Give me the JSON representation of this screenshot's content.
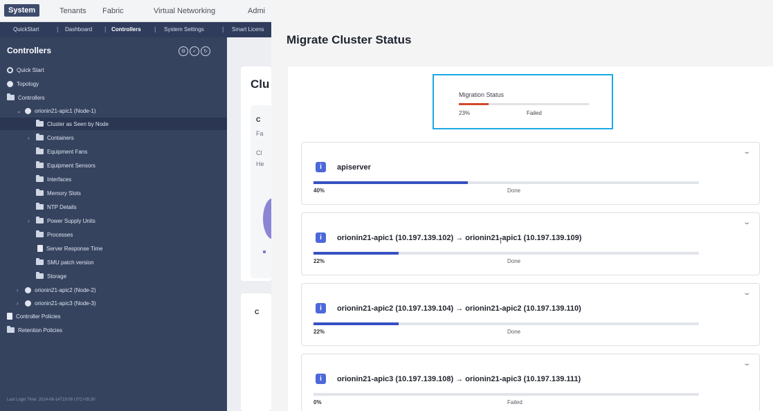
{
  "topnav": {
    "tabs": [
      "System",
      "Tenants",
      "Fabric",
      "Virtual Networking",
      "Admi"
    ],
    "active_tab": 0
  },
  "subnav": {
    "items": [
      "QuickStart",
      "Dashboard",
      "Controllers",
      "System Settings",
      "Smart Licens"
    ],
    "active_item": 2
  },
  "sidebar": {
    "title": "Controllers",
    "tree": [
      {
        "label": "Quick Start",
        "icon": "play-icon"
      },
      {
        "label": "Topology",
        "icon": "globe-icon"
      },
      {
        "label": "Controllers",
        "icon": "folder-icon"
      },
      {
        "label": "orionin21-apic1 (Node-1)",
        "icon": "node-icon"
      },
      {
        "label": "Cluster as Seen by Node",
        "icon": "folder-icon"
      },
      {
        "label": "Containers",
        "icon": "folder-icon"
      },
      {
        "label": "Equipment Fans",
        "icon": "folder-icon"
      },
      {
        "label": "Equipment Sensors",
        "icon": "folder-icon"
      },
      {
        "label": "Interfaces",
        "icon": "folder-icon"
      },
      {
        "label": "Memory Slots",
        "icon": "folder-icon"
      },
      {
        "label": "NTP Details",
        "icon": "folder-icon"
      },
      {
        "label": "Power Supply Units",
        "icon": "folder-icon"
      },
      {
        "label": "Processes",
        "icon": "folder-icon"
      },
      {
        "label": "Server Response Time",
        "icon": "document-icon"
      },
      {
        "label": "SMU patch version",
        "icon": "folder-icon"
      },
      {
        "label": "Storage",
        "icon": "folder-icon"
      },
      {
        "label": "orionin21-apic2 (Node-2)",
        "icon": "node-icon"
      },
      {
        "label": "orionin21-apic3 (Node-3)",
        "icon": "node-icon"
      },
      {
        "label": "Controller Policies",
        "icon": "document-icon"
      },
      {
        "label": "Retention Policies",
        "icon": "folder-icon"
      }
    ],
    "footer": "Last Login Time: 2024-06-14T19:08 UTC+05:30"
  },
  "background_page": {
    "title": "Clu",
    "letters": [
      "C",
      "Fa",
      "Cl",
      "He",
      "C"
    ]
  },
  "modal": {
    "title": "Migrate Cluster Status",
    "migration": {
      "label": "Migration Status",
      "percent": "23%",
      "progress": 0.23,
      "status": "Failed",
      "bar_color": "#d4462b"
    },
    "tasks": [
      {
        "title": "apiserver",
        "percent": "40%",
        "progress": 0.4,
        "status": "Done"
      },
      {
        "title": "orionin21-apic1 (10.197.139.102) → orionin21-apic1 (10.197.139.109)",
        "percent": "22%",
        "progress": 0.22,
        "status": "Done"
      },
      {
        "title": "orionin21-apic2 (10.197.139.104) → orionin21-apic2 (10.197.139.110)",
        "percent": "22%",
        "progress": 0.22,
        "status": "Done"
      },
      {
        "title": "orionin21-apic3 (10.197.139.108) → orionin21-apic3 (10.197.139.111)",
        "percent": "0%",
        "progress": 0.0,
        "status": "Failed"
      }
    ]
  },
  "colors": {
    "highlight_border": "#1ba9e2",
    "progress_blue": "#3651c1",
    "sidebar_bg": "#35435f"
  }
}
